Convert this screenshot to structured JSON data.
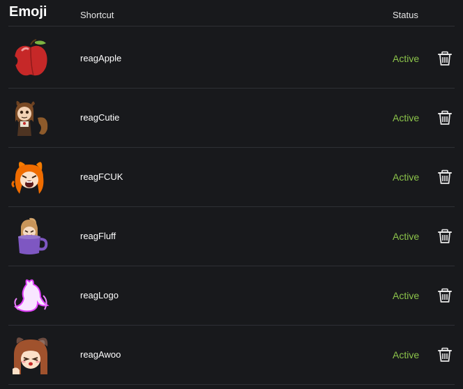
{
  "header": {
    "emoji_title": "Emoji",
    "shortcut_label": "Shortcut",
    "status_label": "Status"
  },
  "colors": {
    "background": "#18191c",
    "divider": "#2e3035",
    "status_active": "#8bc34a"
  },
  "rows": [
    {
      "shortcut": "reagApple",
      "status": "Active",
      "icon": "apple-emoji-icon"
    },
    {
      "shortcut": "reagCutie",
      "status": "Active",
      "icon": "fox-girl-cutie-emoji-icon"
    },
    {
      "shortcut": "reagFCUK",
      "status": "Active",
      "icon": "fox-girl-shouting-emoji-icon"
    },
    {
      "shortcut": "reagFluff",
      "status": "Active",
      "icon": "girl-in-mug-emoji-icon"
    },
    {
      "shortcut": "reagLogo",
      "status": "Active",
      "icon": "glowing-silhouette-logo-emoji-icon"
    },
    {
      "shortcut": "reagAwoo",
      "status": "Active",
      "icon": "wolf-girl-awoo-emoji-icon"
    }
  ]
}
